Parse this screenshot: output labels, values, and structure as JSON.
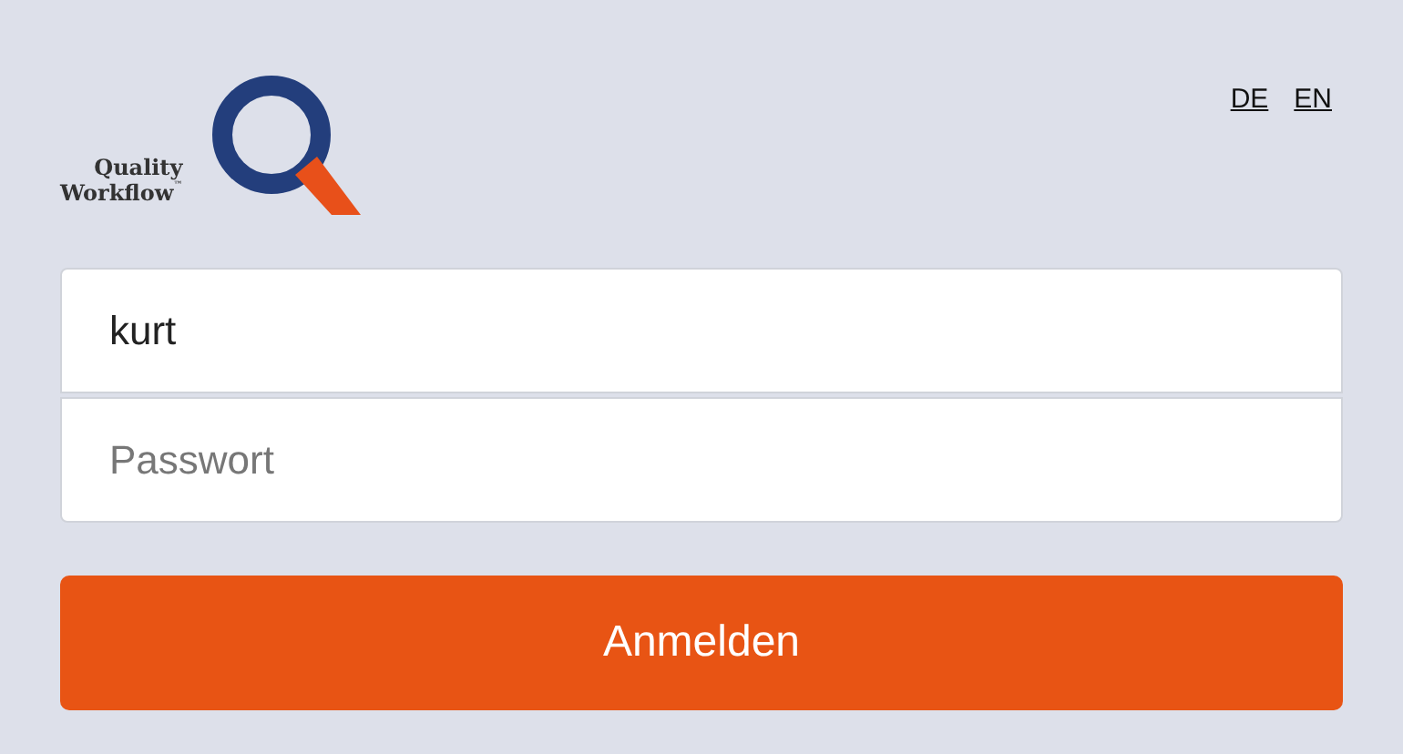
{
  "logo": {
    "line_1": "Quality",
    "line_2": "Workflow",
    "trademark": "™"
  },
  "languages": [
    {
      "label": "DE"
    },
    {
      "label": "EN"
    }
  ],
  "username": {
    "value": "kurt"
  },
  "password": {
    "placeholder": "Passwort"
  },
  "login_button": {
    "label": "Anmelden"
  }
}
